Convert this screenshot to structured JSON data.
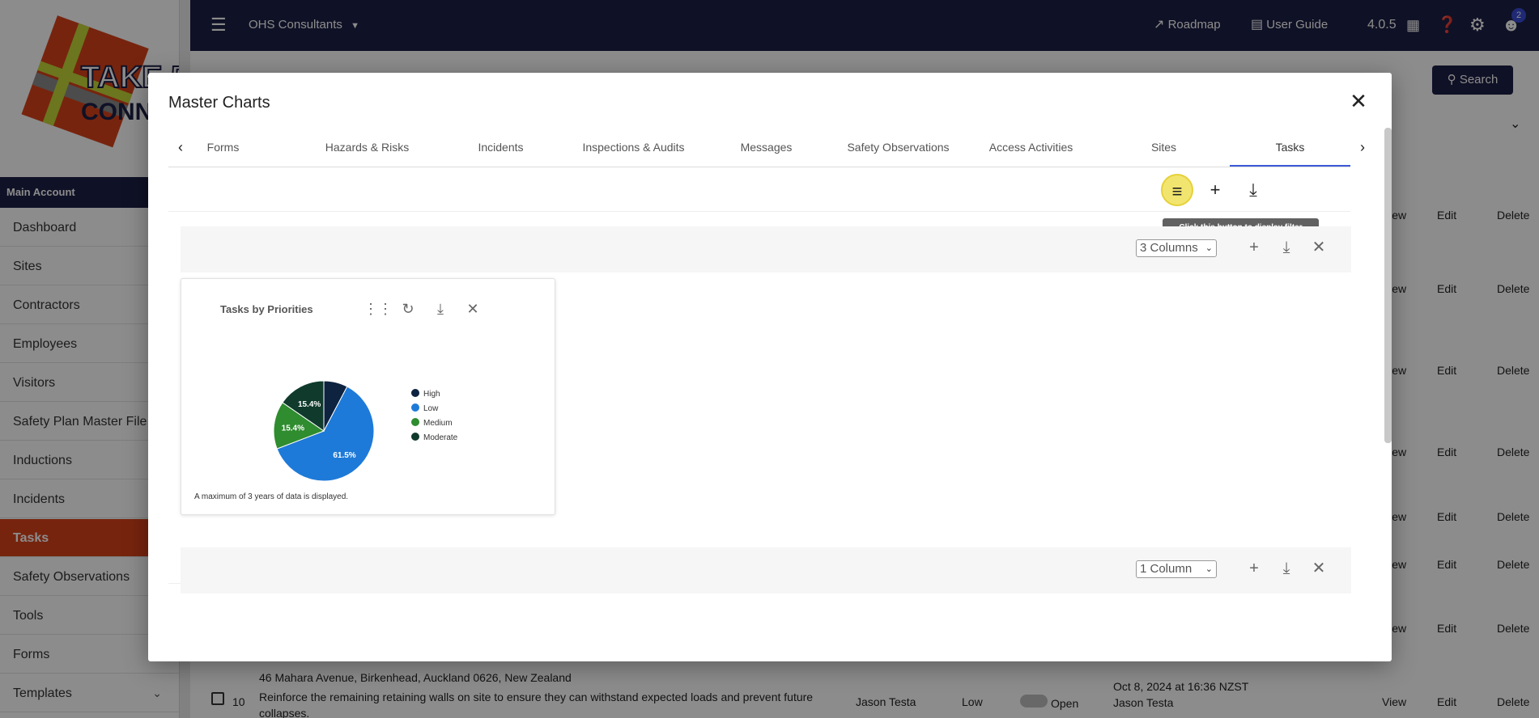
{
  "sidebar": {
    "main_account": "Main Account",
    "items": [
      {
        "label": "Dashboard"
      },
      {
        "label": "Sites"
      },
      {
        "label": "Contractors"
      },
      {
        "label": "Employees"
      },
      {
        "label": "Visitors"
      },
      {
        "label": "Safety Plan Master File"
      },
      {
        "label": "Inductions"
      },
      {
        "label": "Incidents"
      },
      {
        "label": "Tasks",
        "active": true
      },
      {
        "label": "Safety Observations"
      },
      {
        "label": "Tools"
      },
      {
        "label": "Forms"
      },
      {
        "label": "Templates"
      }
    ]
  },
  "topbar": {
    "org_name": "OHS Consultants",
    "roadmap": "Roadmap",
    "user_guide": "User Guide",
    "version": "4.0.5",
    "notifications": "2"
  },
  "background": {
    "search_label": "Search",
    "row_actions": [
      "View",
      "Edit",
      "Delete"
    ],
    "last_row": {
      "number": "10",
      "address": "46 Mahara Avenue, Birkenhead, Auckland 0626, New Zealand",
      "description": "Reinforce the remaining retaining walls on site to ensure they can withstand expected loads and prevent future collapses.",
      "assignee": "Jason Testa",
      "priority": "Low",
      "status": "Open",
      "date": "Oct 8, 2024 at 16:36 NZST",
      "creator": "Jason Testa"
    }
  },
  "modal": {
    "title": "Master Charts",
    "tabs": [
      "Forms",
      "Hazards & Risks",
      "Incidents",
      "Inspections & Audits",
      "Messages",
      "Safety Observations",
      "Access Activities",
      "Sites",
      "Tasks"
    ],
    "active_tab": "Tasks",
    "tooltip": "Click this button to display filter options.",
    "rows": [
      {
        "columns": "3 Columns"
      },
      {
        "columns": "1 Column"
      }
    ],
    "chart_card": {
      "footer": "A maximum of 3 years of data is displayed."
    }
  },
  "colors": {
    "navy": "#1d1f45",
    "accent_orange": "#d9431b",
    "high": "#0d2340",
    "low": "#1e7ad8",
    "medium": "#2f8c2f",
    "moderate": "#0f3a2c"
  },
  "chart_data": {
    "type": "pie",
    "title": "Tasks by Priorities",
    "legend_position": "right",
    "categories": [
      "High",
      "Low",
      "Medium",
      "Moderate"
    ],
    "values": [
      7.7,
      61.5,
      15.4,
      15.4
    ],
    "labels": [
      "",
      "61.5%",
      "15.4%",
      "15.4%"
    ]
  }
}
